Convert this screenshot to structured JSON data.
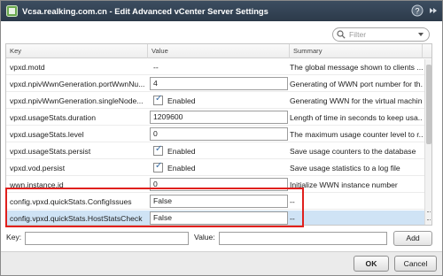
{
  "window": {
    "title": "Vcsa.realking.com.cn - Edit Advanced vCenter Server Settings"
  },
  "filter": {
    "placeholder": "Filter"
  },
  "grid": {
    "columns": {
      "key": "Key",
      "value": "Value",
      "summary": "Summary"
    },
    "rows": [
      {
        "key": "vpxd.motd",
        "type": "text",
        "value": "--",
        "summary": "The global message shown to clients ..."
      },
      {
        "key": "vpxd.npivWwnGeneration.portWwnNu...",
        "type": "input",
        "value": "4",
        "summary": "Generating of WWN port number for th..."
      },
      {
        "key": "vpxd.npivWwnGeneration.singleNode...",
        "type": "checkbox",
        "value": "Enabled",
        "summary": "Generating WWN for the virtual machine"
      },
      {
        "key": "vpxd.usageStats.duration",
        "type": "input",
        "value": "1209600",
        "summary": "Length of time in seconds to keep usa..."
      },
      {
        "key": "vpxd.usageStats.level",
        "type": "input",
        "value": "0",
        "summary": "The maximum usage counter level to r..."
      },
      {
        "key": "vpxd.usageStats.persist",
        "type": "checkbox",
        "value": "Enabled",
        "summary": "Save usage counters to the database"
      },
      {
        "key": "vpxd.vod.persist",
        "type": "checkbox",
        "value": "Enabled",
        "summary": "Save usage statistics to a log file"
      },
      {
        "key": "wwn.instance.id",
        "type": "input",
        "value": "0",
        "summary": "Initialize WWN instance number"
      },
      {
        "key": "config.vpxd.quickStats.ConfigIssues",
        "type": "input",
        "value": "False",
        "summary": "--"
      },
      {
        "key": "config.vpxd.quickStats.HostStatsCheck",
        "type": "input",
        "value": "False",
        "summary": "--",
        "selected": true
      }
    ]
  },
  "add_entry": {
    "key_label": "Key:",
    "value_label": "Value:",
    "add_button": "Add"
  },
  "footer": {
    "ok_button": "OK",
    "cancel_button": "Cancel"
  },
  "colors": {
    "titlebar": "#2c3a4a",
    "selection": "#cfe3f5",
    "highlight_border": "#e0201d"
  }
}
